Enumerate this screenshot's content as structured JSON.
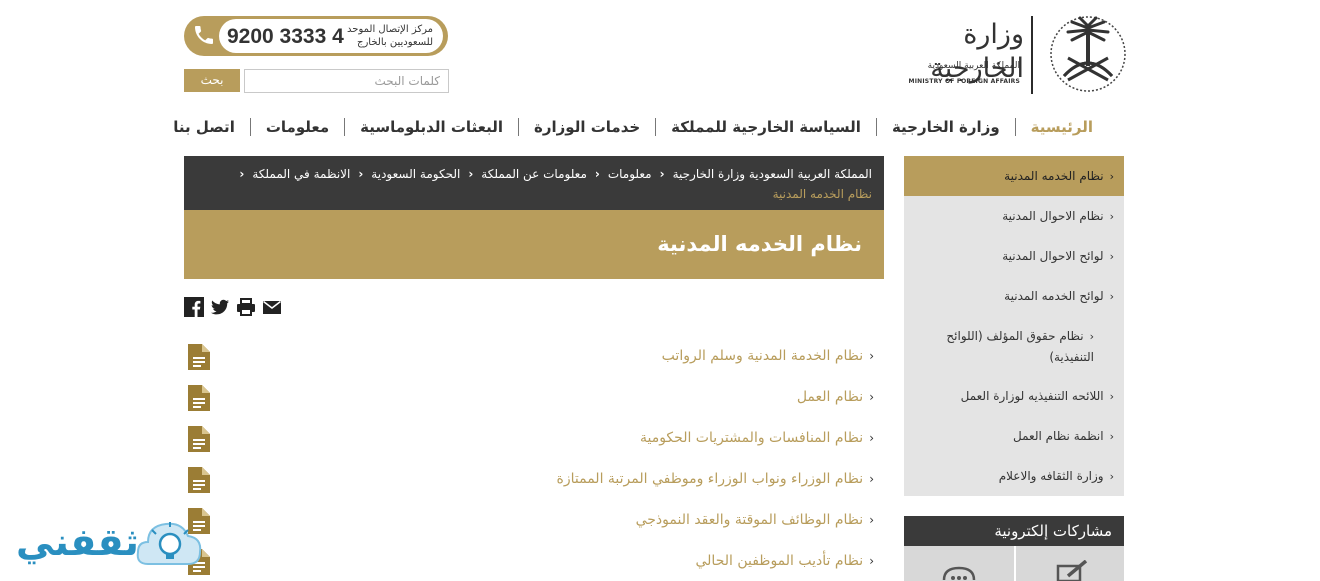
{
  "header": {
    "logo": {
      "arabic_name": "وزارة الخارجية",
      "subtitle": "المملكة العربية السعودية",
      "english": "MINISTRY OF FOREIGN AFFAIRS"
    },
    "phone": {
      "label": "مركز الإتصال الموحد للسعوديين بالخارج",
      "number": "9200 3333 4"
    },
    "search": {
      "placeholder": "كلمات البحث",
      "button_label": "بحث"
    }
  },
  "nav": {
    "items": [
      {
        "label": "الرئيسية",
        "active": true
      },
      {
        "label": "وزارة الخارجية",
        "active": false
      },
      {
        "label": "السياسة الخارجية للمملكة",
        "active": false
      },
      {
        "label": "خدمات الوزارة",
        "active": false
      },
      {
        "label": "البعثات الدبلوماسية",
        "active": false
      },
      {
        "label": "معلومات",
        "active": false
      },
      {
        "label": "اتصل بنا",
        "active": false
      }
    ]
  },
  "breadcrumb": {
    "items": [
      "المملكة العربية السعودية وزارة الخارجية",
      "معلومات",
      "معلومات عن المملكة",
      "الحكومة السعودية",
      "الانظمة في المملكة"
    ],
    "current": "نظام الخدمه المدنية"
  },
  "page": {
    "title": "نظام الخدمه المدنية"
  },
  "share": {
    "icons": [
      "facebook-icon",
      "twitter-icon",
      "print-icon",
      "email-icon"
    ]
  },
  "documents": [
    "نظام الخدمة المدنية وسلم الرواتب",
    "نظام العمل",
    "نظام المنافسات والمشتريات الحكومية",
    "نظام الوزراء ونواب الوزراء وموظفي المرتبة الممتازة",
    "نظام الوظائف الموقتة والعقد النموذجي",
    "نظام تأديب الموظفين الحالي"
  ],
  "sidebar": {
    "items": [
      {
        "label": "نظام الخدمه المدنية",
        "active": true
      },
      {
        "label": "نظام الاحوال المدنية",
        "active": false
      },
      {
        "label": "لوائح الاحوال المدنية",
        "active": false
      },
      {
        "label": "لوائح الخدمه المدنية",
        "active": false
      },
      {
        "label": "نظام حقوق المؤلف (اللوائح التنفيذية)",
        "active": false
      },
      {
        "label": "اللائحه التنفيذيه لوزارة العمل",
        "active": false
      },
      {
        "label": "انظمة نظام العمل",
        "active": false
      },
      {
        "label": "وزارة الثقافه والاعلام",
        "active": false
      }
    ]
  },
  "eparticipation": {
    "title": "مشاركات إلكترونية"
  },
  "watermark": {
    "text": "ثقفني"
  },
  "colors": {
    "accent_gold": "#b89d5c",
    "dark_bar": "#3a3a3a",
    "sidebar_bg": "#e4e4e4"
  }
}
